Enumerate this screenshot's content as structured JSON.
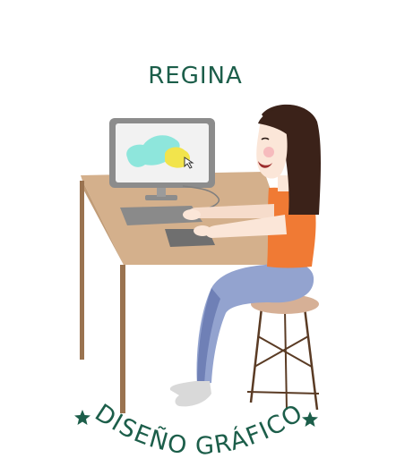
{
  "logo": {
    "name_text": "REGINA",
    "subtitle_text": "DISEÑO GRÁFICO",
    "colors": {
      "brand_green": "#1c5e4a",
      "desk": "#d4b08c",
      "desk_edge": "#c19c77",
      "desk_legs": "#9a7350",
      "monitor_body": "#8c8c8c",
      "monitor_screen": "#f2f2f2",
      "screen_blob_cyan": "#8ee6dc",
      "screen_blob_yellow": "#f2e44c",
      "shirt": "#f07a34",
      "pants": "#93a3cf",
      "pants_shadow": "#6f80b6",
      "skin": "#fbe6d8",
      "hair": "#3b2219",
      "stool_seat": "#d6b096",
      "stool_legs": "#5a3b24",
      "shoes": "#d9d9d9"
    },
    "icons": [
      "star-icon",
      "star-icon"
    ]
  }
}
